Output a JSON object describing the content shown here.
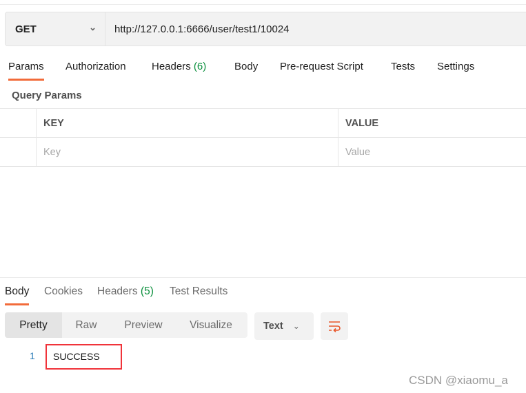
{
  "request": {
    "method": "GET",
    "url": "http://127.0.0.1:6666/user/test1/10024"
  },
  "request_tabs": [
    {
      "label": "Params"
    },
    {
      "label": "Authorization"
    },
    {
      "label": "Headers",
      "count": "(6)"
    },
    {
      "label": "Body"
    },
    {
      "label": "Pre-request Script"
    },
    {
      "label": "Tests"
    },
    {
      "label": "Settings"
    }
  ],
  "query_params": {
    "title": "Query Params",
    "headers": [
      "KEY",
      "VALUE"
    ],
    "placeholders": [
      "Key",
      "Value"
    ]
  },
  "response_tabs": [
    {
      "label": "Body"
    },
    {
      "label": "Cookies"
    },
    {
      "label": "Headers",
      "count": "(5)"
    },
    {
      "label": "Test Results"
    }
  ],
  "view_modes": [
    "Pretty",
    "Raw",
    "Preview",
    "Visualize"
  ],
  "format": "Text",
  "response_body": {
    "line": "1",
    "text": "SUCCESS"
  },
  "watermark": "CSDN @xiaomu_a",
  "colors": {
    "accent": "#f26b3a",
    "count": "#0a8f3c",
    "highlight": "#f0333a"
  }
}
